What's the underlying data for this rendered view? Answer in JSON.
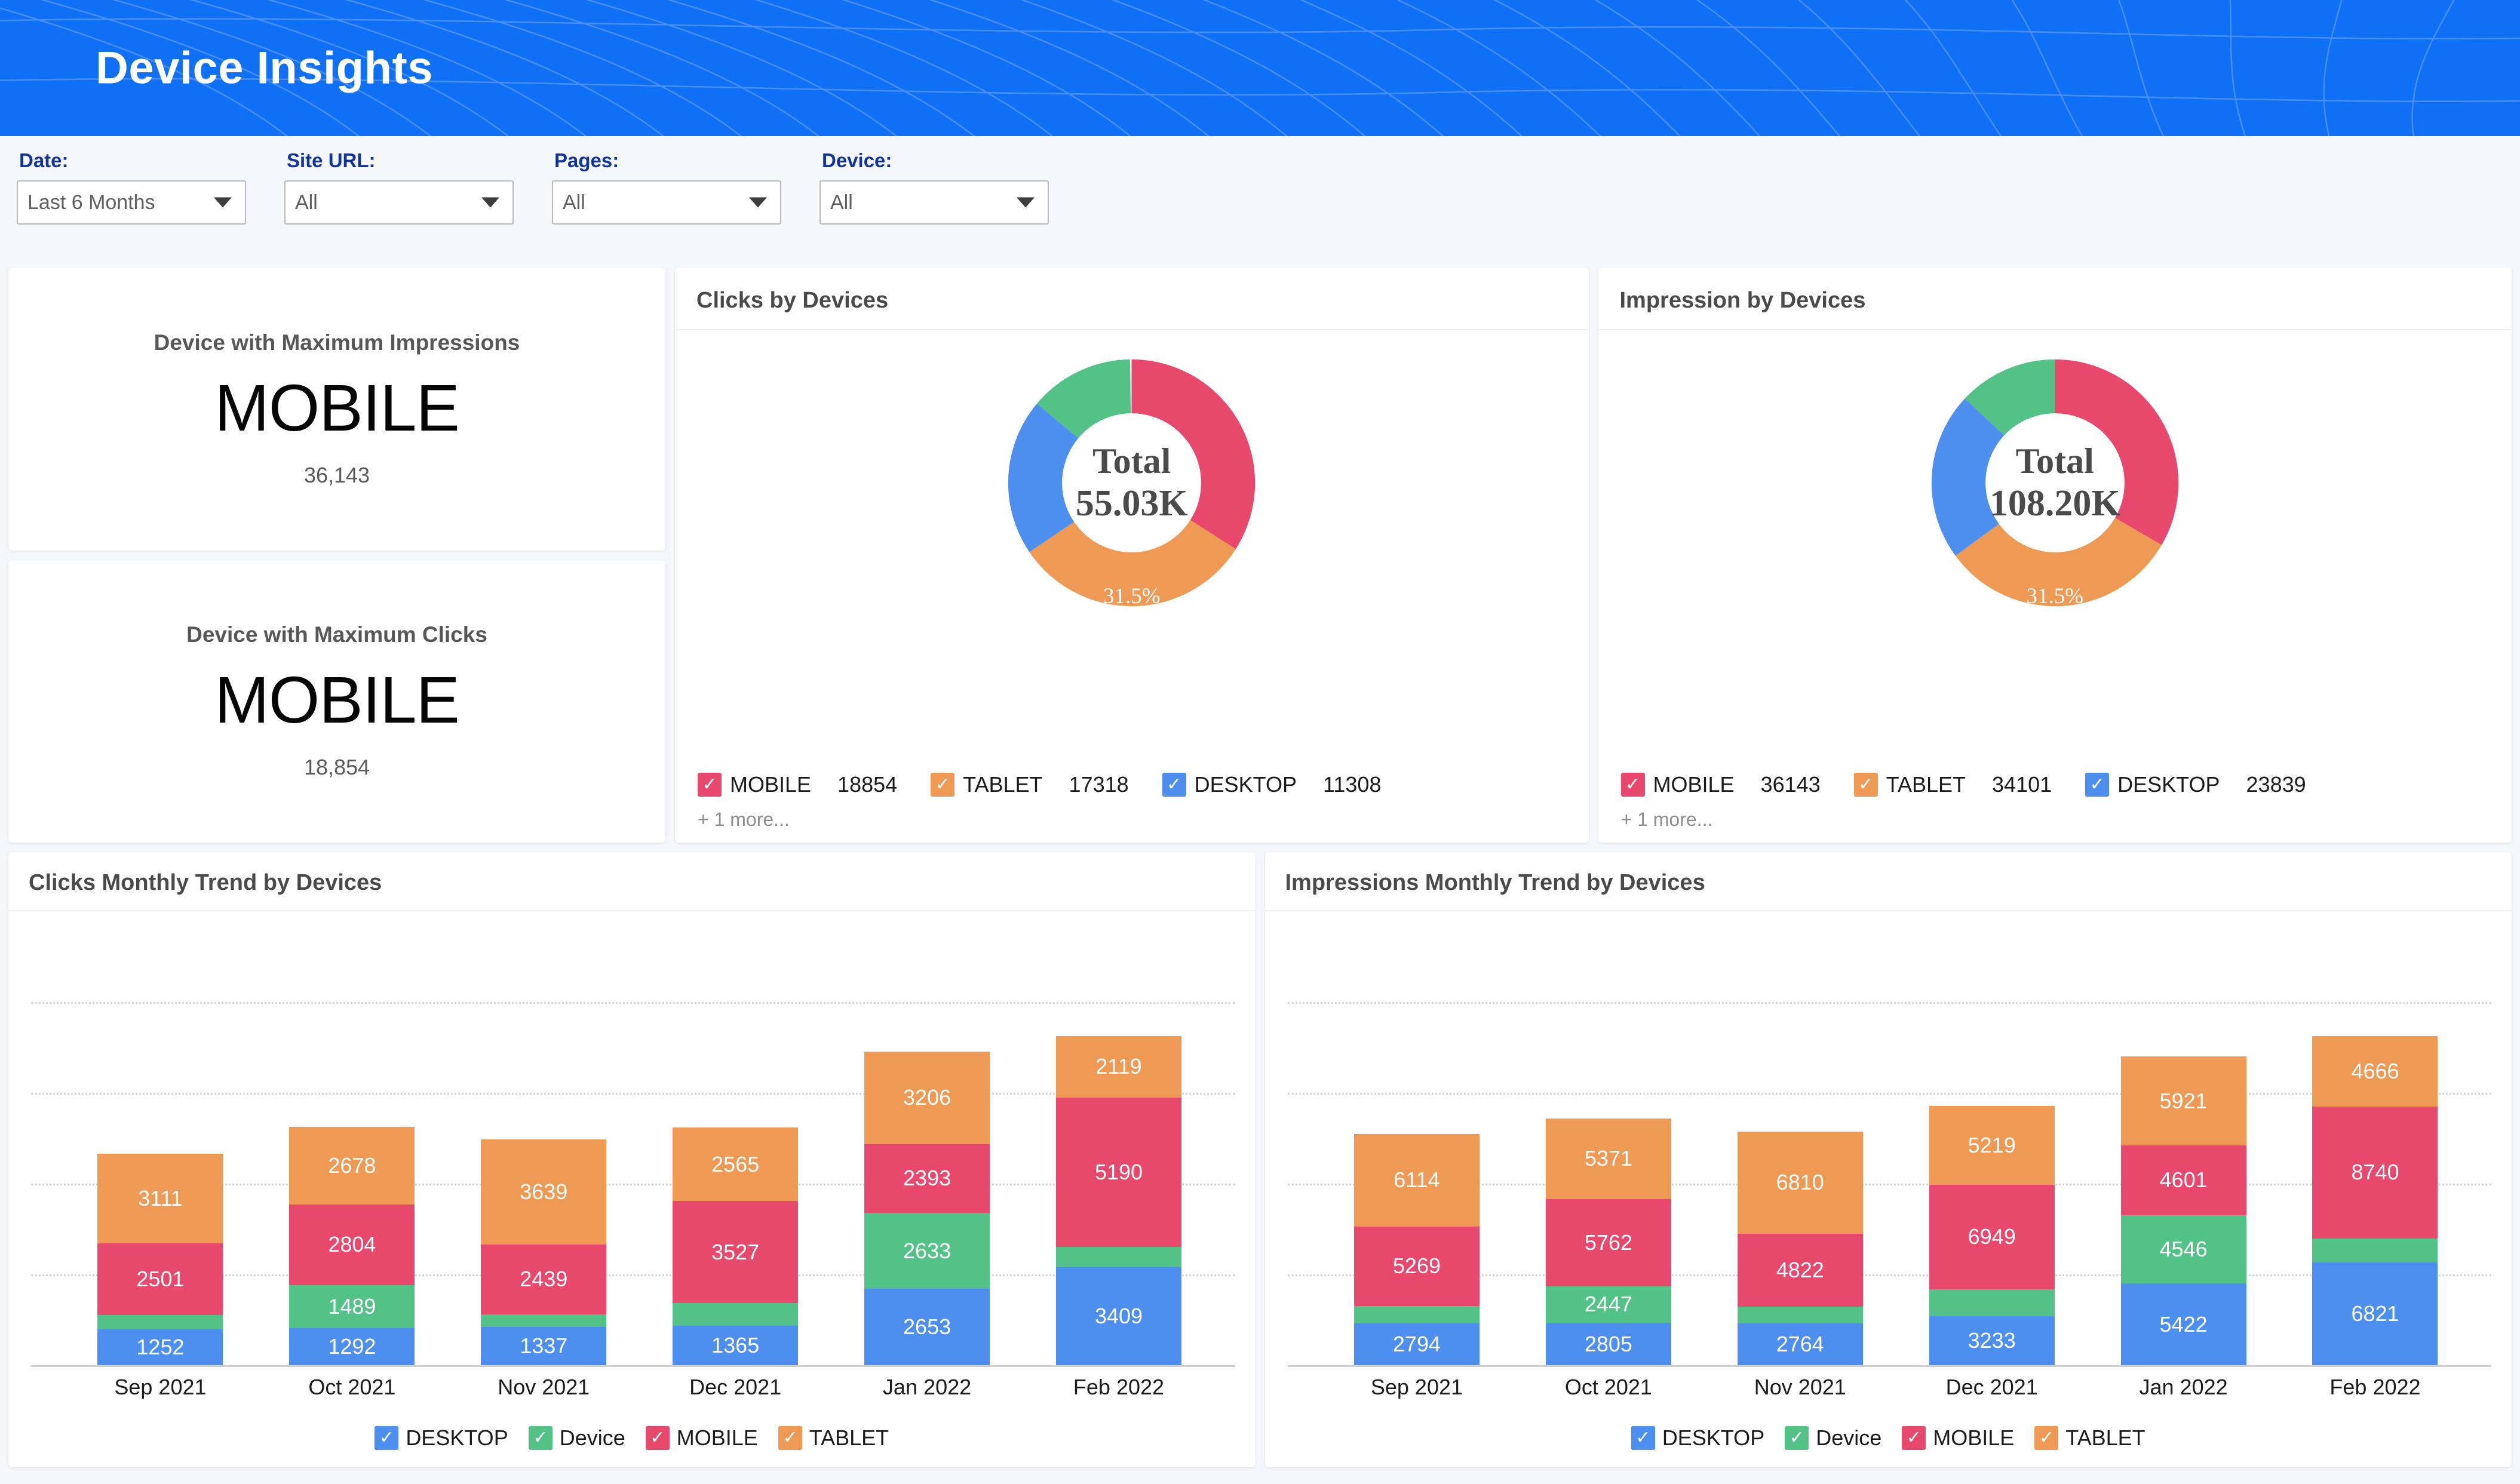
{
  "header": {
    "title": "Device Insights"
  },
  "filters": [
    {
      "label": "Date:",
      "value": "Last 6 Months",
      "name": "date"
    },
    {
      "label": "Site URL:",
      "value": "All",
      "name": "site-url"
    },
    {
      "label": "Pages:",
      "value": "All",
      "name": "pages"
    },
    {
      "label": "Device:",
      "value": "All",
      "name": "device"
    }
  ],
  "kpis": [
    {
      "title": "Device with Maximum Impressions",
      "value": "MOBILE",
      "sub": "36,143"
    },
    {
      "title": "Device with Maximum Clicks",
      "value": "MOBILE",
      "sub": "18,854"
    }
  ],
  "colors": {
    "mobile": "#E8486B",
    "tablet": "#EF9A54",
    "desktop": "#4D8FEE",
    "device": "#52C287",
    "banner": "#1070f5",
    "page_bg": "#f4f6fb"
  },
  "donuts": [
    {
      "title": "Clicks by Devices",
      "center_label": "Total",
      "center_value": "55.03K",
      "highlight_pct": "31.5%",
      "more": "+ 1 more...",
      "legend": [
        {
          "name": "MOBILE",
          "value": "18854",
          "color": "#E8486B"
        },
        {
          "name": "TABLET",
          "value": "17318",
          "color": "#EF9A54"
        },
        {
          "name": "DESKTOP",
          "value": "11308",
          "color": "#4D8FEE"
        }
      ]
    },
    {
      "title": "Impression by Devices",
      "center_label": "Total",
      "center_value": "108.20K",
      "highlight_pct": "31.5%",
      "more": "+ 1 more...",
      "legend": [
        {
          "name": "MOBILE",
          "value": "36143",
          "color": "#E8486B"
        },
        {
          "name": "TABLET",
          "value": "34101",
          "color": "#EF9A54"
        },
        {
          "name": "DESKTOP",
          "value": "23839",
          "color": "#4D8FEE"
        }
      ]
    }
  ],
  "bar_legend": [
    {
      "name": "DESKTOP",
      "color": "#4D8FEE"
    },
    {
      "name": "Device",
      "color": "#52C287"
    },
    {
      "name": "MOBILE",
      "color": "#E8486B"
    },
    {
      "name": "TABLET",
      "color": "#EF9A54"
    }
  ],
  "charts": {
    "clicks_trend_title": "Clicks Monthly Trend by Devices",
    "impressions_trend_title": "Impressions Monthly Trend by Devices"
  },
  "chart_data": [
    {
      "type": "pie",
      "title": "Clicks by Devices",
      "subtitle": "Total 55.03K",
      "labels": [
        "MOBILE",
        "TABLET",
        "DESKTOP",
        "Device"
      ],
      "values": [
        18854,
        17318,
        11308,
        7550
      ],
      "colors": [
        "#E8486B",
        "#EF9A54",
        "#4D8FEE",
        "#52C287"
      ],
      "annotations": [
        "31.5%"
      ],
      "legend": "bottom",
      "donut": true
    },
    {
      "type": "pie",
      "title": "Impression by Devices",
      "subtitle": "Total 108.20K",
      "labels": [
        "MOBILE",
        "TABLET",
        "DESKTOP",
        "Device"
      ],
      "values": [
        36143,
        34101,
        23839,
        14117
      ],
      "colors": [
        "#E8486B",
        "#EF9A54",
        "#4D8FEE",
        "#52C287"
      ],
      "annotations": [
        "31.5%"
      ],
      "legend": "bottom",
      "donut": true
    },
    {
      "type": "bar",
      "stacked": true,
      "title": "Clicks Monthly Trend by Devices",
      "xlabel": "",
      "ylabel": "",
      "grid": true,
      "legend": "bottom",
      "categories": [
        "Sep 2021",
        "Oct 2021",
        "Nov 2021",
        "Dec 2021",
        "Jan 2022",
        "Feb 2022"
      ],
      "series": [
        {
          "name": "DESKTOP",
          "color": "#4D8FEE",
          "values": [
            1252,
            1292,
            1337,
            1365,
            2653,
            3409
          ]
        },
        {
          "name": "Device",
          "color": "#52C287",
          "values": [
            480,
            1489,
            420,
            800,
            2633,
            700
          ]
        },
        {
          "name": "MOBILE",
          "color": "#E8486B",
          "values": [
            2501,
            2804,
            2439,
            3527,
            2393,
            5190
          ]
        },
        {
          "name": "TABLET",
          "color": "#EF9A54",
          "values": [
            3111,
            2678,
            3639,
            2565,
            3206,
            2119
          ]
        }
      ],
      "totals": [
        7344,
        8263,
        7835,
        8257,
        10885,
        11418
      ]
    },
    {
      "type": "bar",
      "stacked": true,
      "title": "Impressions Monthly Trend by Devices",
      "xlabel": "",
      "ylabel": "",
      "grid": true,
      "legend": "bottom",
      "categories": [
        "Sep 2021",
        "Oct 2021",
        "Nov 2021",
        "Dec 2021",
        "Jan 2022",
        "Feb 2022"
      ],
      "series": [
        {
          "name": "DESKTOP",
          "color": "#4D8FEE",
          "values": [
            2794,
            2805,
            2764,
            3233,
            5422,
            6821
          ]
        },
        {
          "name": "Device",
          "color": "#52C287",
          "values": [
            1150,
            2447,
            1120,
            1800,
            4546,
            1600
          ]
        },
        {
          "name": "MOBILE",
          "color": "#E8486B",
          "values": [
            5269,
            5762,
            4822,
            6949,
            4601,
            8740
          ]
        },
        {
          "name": "TABLET",
          "color": "#EF9A54",
          "values": [
            6114,
            5371,
            6810,
            5219,
            5921,
            4666
          ]
        }
      ],
      "totals": [
        15327,
        16385,
        15516,
        17201,
        20490,
        21827
      ]
    }
  ]
}
